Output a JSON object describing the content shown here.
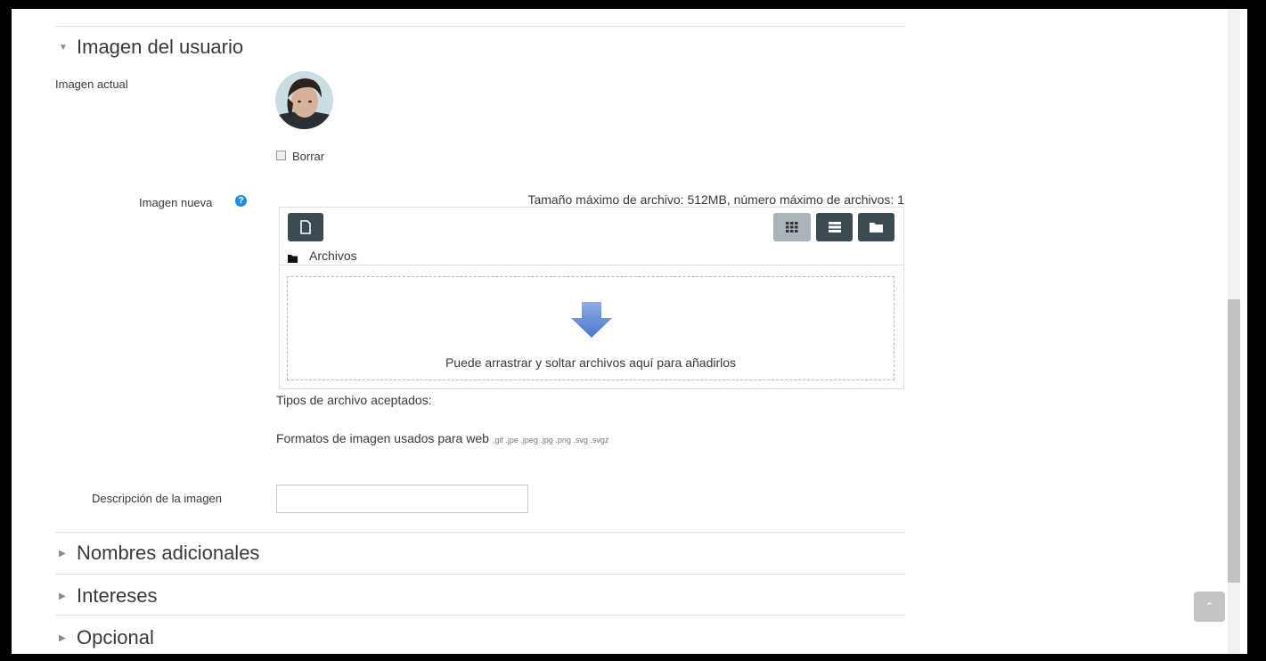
{
  "sections": {
    "user_picture": "Imagen del usuario",
    "additional_names": "Nombres adicionales",
    "interests": "Intereses",
    "optional": "Opcional"
  },
  "current_picture": {
    "label": "Imagen actual",
    "delete_label": "Borrar"
  },
  "new_picture": {
    "label": "Imagen nueva",
    "limits": "Tamaño máximo de archivo: 512MB, número máximo de archivos: 1",
    "path_label": "Archivos",
    "drop_hint": "Puede arrastrar y soltar archivos aquí para añadirlos",
    "accepted_label": "Tipos de archivo aceptados:",
    "format_name": "Formatos de imagen usados para web",
    "format_exts": ".gif .jpe .jpeg .jpg .png .svg .svgz"
  },
  "image_description": {
    "label": "Descripción de la imagen",
    "value": ""
  },
  "icons": {
    "add_file": "file-icon",
    "view_icons": "grid-icon",
    "view_list": "list-icon",
    "view_tree": "folder-icon",
    "help": "help-icon",
    "back_to_top": "chevron-up-icon"
  },
  "colors": {
    "button_dark": "#3c4a53",
    "button_active": "#a9b4ba",
    "help_blue": "#1f8ce6",
    "drop_arrow": "#6f93d8"
  }
}
